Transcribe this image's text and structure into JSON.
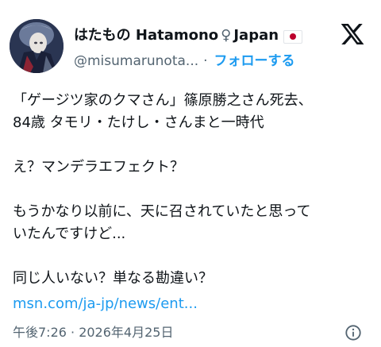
{
  "author": {
    "display_name": "はたもの Hatamono",
    "name_symbol": "♀",
    "name_suffix": "Japan",
    "flag_icon": "japan-flag-icon",
    "handle": "@misumarunota...",
    "separator": "·",
    "follow_label": "フォローする"
  },
  "tweet": {
    "text": "「ゲージツ家のクマさん」篠原勝之さん死去、\n84歳 タモリ・たけし・さんまと一時代\n\nえ？マンデラエフェクト？\n\nもうかなり以前に、天に召されていたと思って\nいたんですけど...\n\n同じ人いない？単なる勘違い？",
    "link_text": "msn.com/ja-jp/news/ent...",
    "timestamp": "午後7:26 · 2026年4月25日"
  },
  "icons": {
    "logo": "x-logo-icon",
    "info": "info-icon"
  },
  "colors": {
    "text": "#0f1419",
    "secondary": "#536471",
    "accent": "#1d9bf0"
  }
}
